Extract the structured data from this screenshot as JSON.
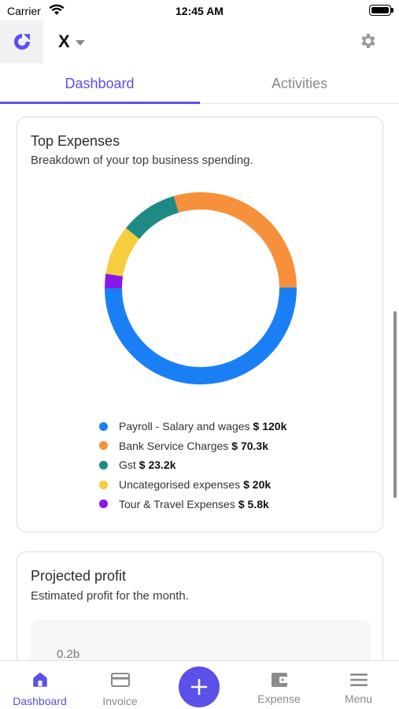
{
  "status_bar": {
    "carrier": "Carrier",
    "time": "12:45 AM"
  },
  "header": {
    "logo_icon": "app-logo-icon",
    "company_name": "X",
    "settings_icon": "gear-icon"
  },
  "tabs": [
    {
      "label": "Dashboard",
      "active": true
    },
    {
      "label": "Activities",
      "active": false
    }
  ],
  "top_expenses": {
    "title": "Top Expenses",
    "subtitle": "Breakdown of your top business spending.",
    "items": [
      {
        "label": "Payroll - Salary and wages",
        "value": "$ 120k",
        "color": "#1a7ff5"
      },
      {
        "label": "Bank Service Charges",
        "value": "$ 70.3k",
        "color": "#f6903a"
      },
      {
        "label": "Gst",
        "value": "$ 23.2k",
        "color": "#1f8a85"
      },
      {
        "label": "Uncategorised expenses",
        "value": "$ 20k",
        "color": "#f6cd3d"
      },
      {
        "label": "Tour & Travel Expenses",
        "value": "$ 5.8k",
        "color": "#8a17ea"
      }
    ]
  },
  "chart_data": {
    "type": "pie",
    "title": "Top Expenses",
    "categories": [
      "Payroll - Salary and wages",
      "Bank Service Charges",
      "Gst",
      "Uncategorised expenses",
      "Tour & Travel Expenses"
    ],
    "values": [
      120,
      70.3,
      23.2,
      20,
      5.8
    ],
    "colors": [
      "#1a7ff5",
      "#f6903a",
      "#1f8a85",
      "#f6cd3d",
      "#8a17ea"
    ],
    "style": "donut",
    "legend": "bottom"
  },
  "projected_profit": {
    "title": "Projected profit",
    "subtitle": "Estimated profit for the month.",
    "first_tick": "0.2b"
  },
  "bottom_nav": {
    "dashboard": "Dashboard",
    "invoice": "Invoice",
    "expense": "Expense",
    "menu": "Menu"
  },
  "colors": {
    "accent": "#5b50e8"
  }
}
